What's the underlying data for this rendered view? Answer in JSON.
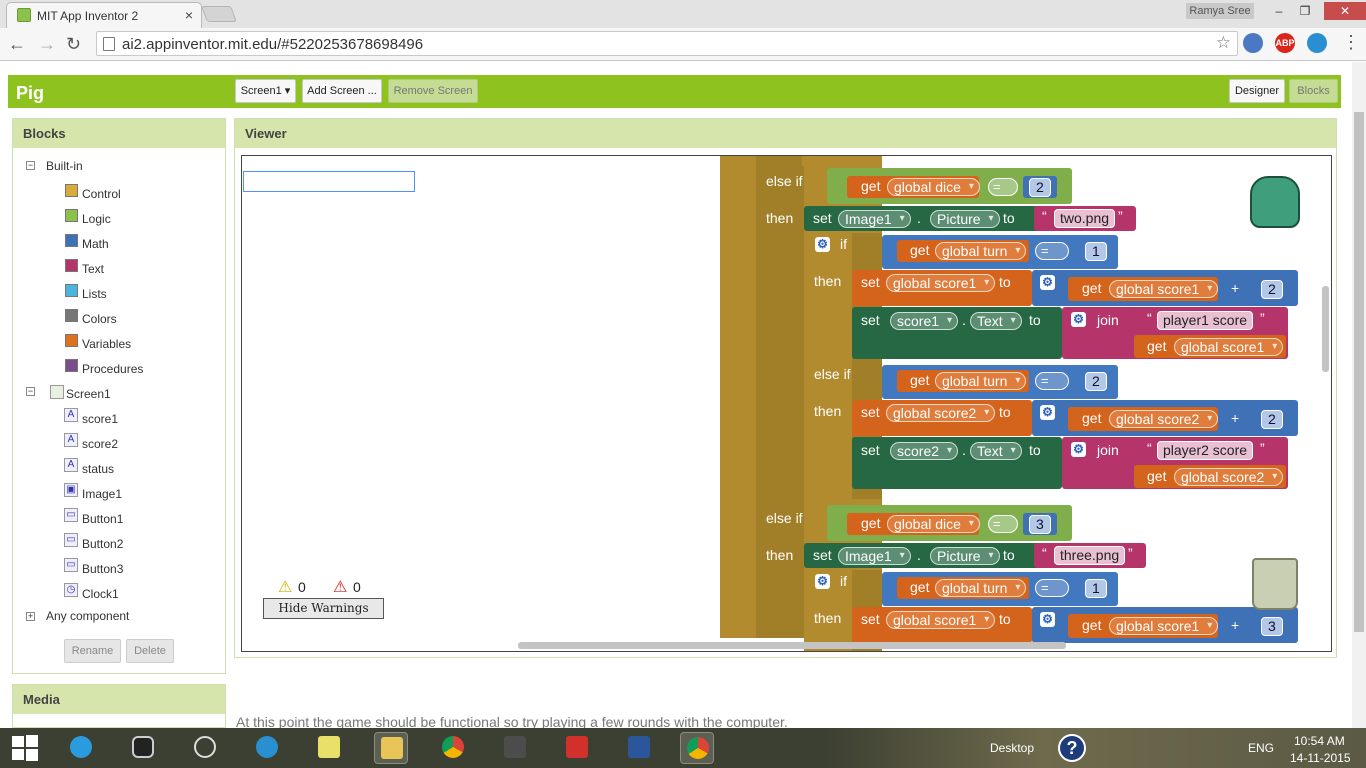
{
  "browser": {
    "tab_title": "MIT App Inventor 2",
    "tab_close": "×",
    "user": "Ramya Sree",
    "win_min": "–",
    "win_max": "❐",
    "win_close": "✕",
    "back": "←",
    "forward": "→",
    "reload": "↻",
    "url": "ai2.appinventor.mit.edu/#5220253678698496",
    "star": "☆",
    "menu": "⋮",
    "ext_abp": "ABP"
  },
  "app": {
    "project": "Pig",
    "screen_dropdown": "Screen1 ▾",
    "add_screen": "Add Screen ...",
    "remove_screen": "Remove Screen",
    "designer": "Designer",
    "blocks": "Blocks"
  },
  "blocks_panel": {
    "title": "Blocks",
    "builtin": "Built-in",
    "categories": [
      {
        "label": "Control",
        "color": "#d8ab3a"
      },
      {
        "label": "Logic",
        "color": "#8bc34a"
      },
      {
        "label": "Math",
        "color": "#3f71b6"
      },
      {
        "label": "Text",
        "color": "#b5356b"
      },
      {
        "label": "Lists",
        "color": "#4ab4e0"
      },
      {
        "label": "Colors",
        "color": "#777777"
      },
      {
        "label": "Variables",
        "color": "#e0711d"
      },
      {
        "label": "Procedures",
        "color": "#7a4d8f"
      }
    ],
    "screen": "Screen1",
    "components": [
      {
        "label": "score1",
        "icon": "label-icon"
      },
      {
        "label": "score2",
        "icon": "label-icon"
      },
      {
        "label": "status",
        "icon": "label-icon"
      },
      {
        "label": "Image1",
        "icon": "image-icon"
      },
      {
        "label": "Button1",
        "icon": "button-icon"
      },
      {
        "label": "Button2",
        "icon": "button-icon"
      },
      {
        "label": "Button3",
        "icon": "button-icon"
      },
      {
        "label": "Clock1",
        "icon": "clock-icon"
      }
    ],
    "any_component": "Any component",
    "rename": "Rename",
    "delete": "Delete"
  },
  "media_panel": {
    "title": "Media"
  },
  "viewer": {
    "title": "Viewer",
    "warnings_count": "0",
    "errors_count": "0",
    "hide_warnings": "Hide Warnings"
  },
  "code": {
    "else_if": "else if",
    "then": "then",
    "if": "if",
    "get": "get",
    "set": "set",
    "to": "to",
    "join": "join",
    "eq": "=",
    "plus": "+",
    "dot": ".",
    "global_dice": "global dice",
    "global_turn": "global turn",
    "global_score1": "global score1",
    "global_score2": "global score2",
    "image1": "Image1",
    "picture": "Picture",
    "score1": "score1",
    "score2": "score2",
    "text_prop": "Text",
    "two_png": "two.png",
    "three_png": "three.png",
    "player1_score": "player1 score",
    "player2_score": "player2 score",
    "n1": "1",
    "n2": "2",
    "n3": "3",
    "q_open": "“",
    "q_close": "”"
  },
  "background_text": "At this point the game should be functional so try playing a few rounds with the computer.",
  "taskbar": {
    "desktop": "Desktop",
    "lang": "ENG",
    "time": "10:54 AM",
    "date": "14-11-2015"
  }
}
